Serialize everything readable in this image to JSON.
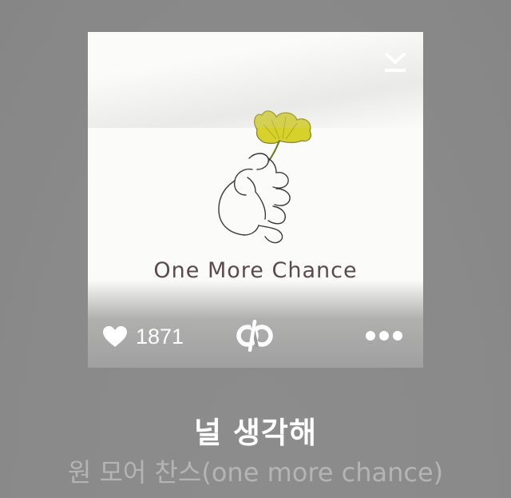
{
  "track": {
    "title": "널 생각해",
    "artist": "원 모어 찬스(one more chance)"
  },
  "album": {
    "cover_text": "One More Chance"
  },
  "actions": {
    "like_count": "1871",
    "download_icon": "download-icon",
    "like_icon": "heart-icon",
    "logo_icon": "melon-logo-icon",
    "more_icon": "more-dots-icon"
  },
  "colors": {
    "background": "#8a8a8a",
    "title": "#ffffff",
    "artist": "#b4b4b4",
    "ginkgo_leaf": "#d4d12a"
  }
}
